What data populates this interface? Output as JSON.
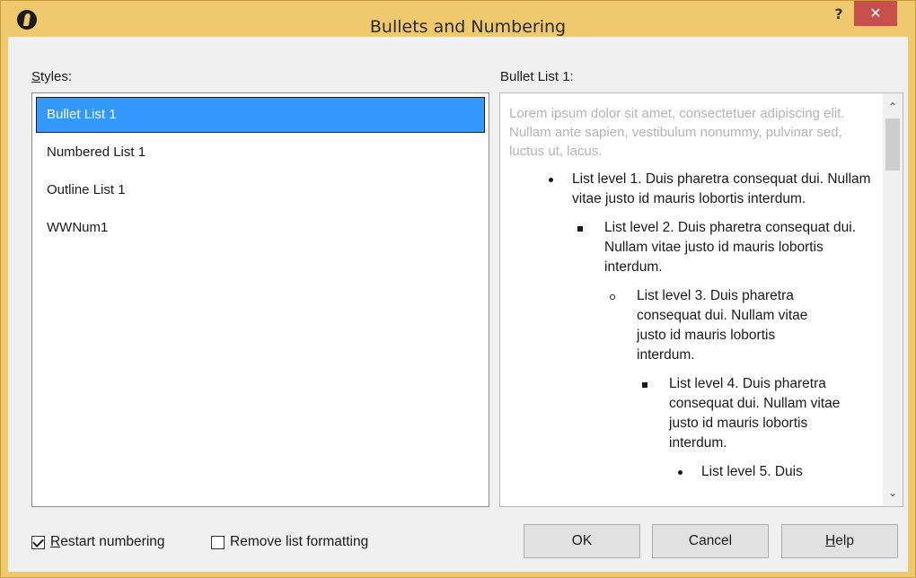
{
  "window": {
    "title": "Bullets and Numbering",
    "help_glyph": "?",
    "close_glyph": "✕"
  },
  "styles_panel": {
    "label_mnemonic": "S",
    "label_rest": "tyles:",
    "items": [
      {
        "label": "Bullet List 1",
        "selected": true
      },
      {
        "label": "Numbered List 1",
        "selected": false
      },
      {
        "label": "Outline List 1",
        "selected": false
      },
      {
        "label": "WWNum1",
        "selected": false
      }
    ]
  },
  "preview_panel": {
    "label": "Bullet List 1:",
    "lorem": "Lorem ipsum dolor sit amet, consectetuer adipiscing elit. Nullam ante sapien, vestibulum nonummy, pulvinar sed, luctus ut, lacus.",
    "levels": [
      {
        "text": "List level 1. Duis pharetra consequat dui. Nullam vitae justo id mauris lobortis interdum.",
        "bullet": "disc"
      },
      {
        "text": "List level 2. Duis pharetra consequat dui. Nullam vitae justo id mauris lobortis interdum.",
        "bullet": "square"
      },
      {
        "text": "List level 3. Duis pharetra consequat dui. Nullam vitae justo id mauris lobortis interdum.",
        "bullet": "circle"
      },
      {
        "text": "List level 4. Duis pharetra consequat dui. Nullam vitae justo id mauris lobortis interdum.",
        "bullet": "square"
      },
      {
        "text": "List level 5. Duis",
        "bullet": "disc"
      }
    ],
    "scroll_up_glyph": "⌃",
    "scroll_down_glyph": "⌄"
  },
  "options": {
    "restart_numbering": {
      "mnemonic": "R",
      "rest": "estart numbering",
      "checked": true
    },
    "remove_list_formatting": {
      "label": "Remove list formatting",
      "checked": false
    }
  },
  "buttons": {
    "ok": "OK",
    "cancel": "Cancel",
    "help_mnemonic": "H",
    "help_rest": "elp"
  },
  "colors": {
    "titlebar": "#f0c96e",
    "selection": "#3399ff",
    "close_button": "#c7504a"
  }
}
